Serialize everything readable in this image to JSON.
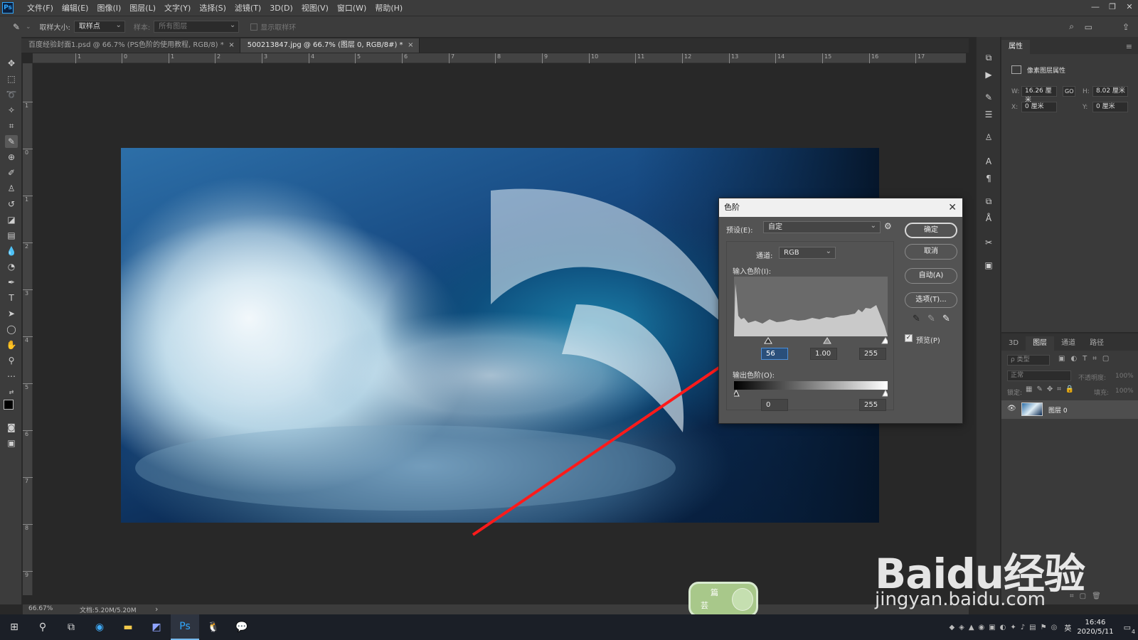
{
  "menubar": {
    "app_icon": "Ps",
    "items": [
      "文件(F)",
      "编辑(E)",
      "图像(I)",
      "图层(L)",
      "文字(Y)",
      "选择(S)",
      "滤镜(T)",
      "3D(D)",
      "视图(V)",
      "窗口(W)",
      "帮助(H)"
    ]
  },
  "options": {
    "sample_size_label": "取样大小:",
    "sample_size_value": "取样点",
    "sample_label": "样本:",
    "sample_value": "所有图层",
    "show_ring_label": "显示取样环"
  },
  "tabs": [
    {
      "label": "百度经验封面1.psd @ 66.7% (PS色阶的使用教程, RGB/8) *",
      "close": "×"
    },
    {
      "label": "500213847.jpg @ 66.7% (图层 0, RGB/8#) *",
      "close": "×"
    }
  ],
  "ruler_h": [
    "1",
    "0",
    "1",
    "2",
    "3",
    "4",
    "5",
    "6",
    "7",
    "8",
    "9",
    "10",
    "11",
    "12",
    "13",
    "14",
    "15",
    "16",
    "17"
  ],
  "ruler_v": [
    "1",
    "0",
    "1",
    "2",
    "3",
    "4",
    "5",
    "6",
    "7",
    "8",
    "9"
  ],
  "status": {
    "zoom": "66.67%",
    "doc": "文档:5.20M/5.20M",
    "arrow": "›"
  },
  "properties": {
    "tab": "属性",
    "title": "像素图层属性",
    "w_label": "W:",
    "w_value": "16.26 厘米",
    "link": "GO",
    "h_label": "H:",
    "h_value": "8.02 厘米",
    "x_label": "X:",
    "x_value": "0 厘米",
    "y_label": "Y:",
    "y_value": "0 厘米"
  },
  "layers": {
    "tabs": [
      "3D",
      "图层",
      "通道",
      "路径"
    ],
    "filter": "ρ 类型",
    "blend": "正常",
    "opacity_label": "不透明度:",
    "opacity_value": "100%",
    "lock_label": "锁定:",
    "fill_label": "填充:",
    "fill_value": "100%",
    "layer_name": "图层 0"
  },
  "levels": {
    "title": "色阶",
    "close": "✕",
    "preset_label": "预设(E):",
    "preset_value": "自定",
    "channel_label": "通道:",
    "channel_value": "RGB",
    "input_label": "输入色阶(I):",
    "input_black": "56",
    "input_gamma": "1.00",
    "input_white": "255",
    "output_label": "输出色阶(O):",
    "output_black": "0",
    "output_white": "255",
    "btn_ok": "确定",
    "btn_cancel": "取消",
    "btn_auto": "自动(A)",
    "btn_options": "选项(T)...",
    "preview_label": "预览(P)",
    "preview_checked": "✓"
  },
  "taskbar": {
    "clock_time": "16:46",
    "clock_date": "2020/5/11",
    "ime": "英",
    "notif_count": "4"
  },
  "badge": {
    "line1": "篇",
    "line2": "芸"
  },
  "watermark": {
    "logo": "Baidu经验",
    "url": "jingyan.baidu.com"
  }
}
